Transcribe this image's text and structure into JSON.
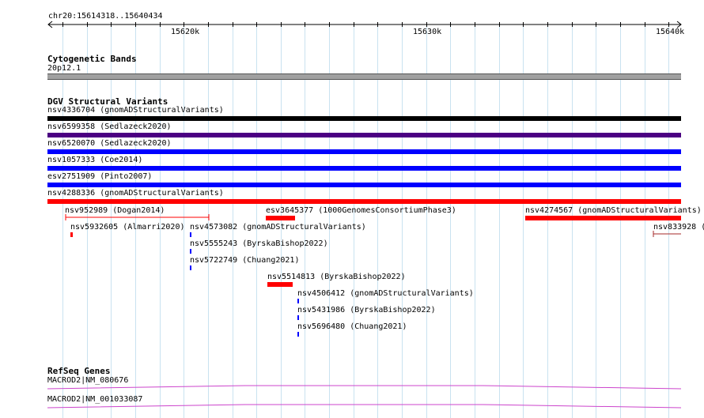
{
  "ruler": {
    "location": "chr20:15614318..15640434",
    "ticks": [
      "15620k",
      "15630k",
      "15640k"
    ]
  },
  "tracks": {
    "cytoband": {
      "title": "Cytogenetic Bands",
      "band_label": "20p12.1",
      "band_color": "#a0a0a0"
    },
    "dgv": {
      "title": "DGV Structural Variants",
      "colors": {
        "loss": "#ff0000",
        "gain": "#0000ff",
        "complex": "#000000",
        "inversion": "#4b0082",
        "brown": "#a52a2a"
      },
      "features": [
        {
          "label": "nsv4336704 (gnomADStructuralVariants)",
          "color": "#000000"
        },
        {
          "label": "nsv6599358 (Sedlazeck2020)",
          "color": "#4b0082"
        },
        {
          "label": "nsv6520070 (Sedlazeck2020)",
          "color": "#0000ff"
        },
        {
          "label": "nsv1057333 (Coe2014)",
          "color": "#0000ff"
        },
        {
          "label": "esv2751909 (Pinto2007)",
          "color": "#0000ff"
        },
        {
          "label": "nsv4288336 (gnomADStructuralVariants)",
          "color": "#ff0000"
        },
        {
          "label": "nsv952989 (Dogan2014)",
          "color": "#ff0000"
        },
        {
          "label": "esv3645377 (1000GenomesConsortiumPhase3)",
          "color": "#ff0000"
        },
        {
          "label": "nsv4274567 (gnomADStructuralVariants)",
          "color": "#ff0000"
        },
        {
          "label": "nsv5932605 (Almarri2020)",
          "color": "#ff0000"
        },
        {
          "label": "nsv4573082 (gnomADStructuralVariants)",
          "color": "#0000ff"
        },
        {
          "label": "nsv833928 (",
          "color": "#a52a2a"
        },
        {
          "label": "nsv5555243 (ByrskaBishop2022)",
          "color": "#0000ff"
        },
        {
          "label": "nsv5722749 (Chuang2021)",
          "color": "#0000ff"
        },
        {
          "label": "nsv5514813 (ByrskaBishop2022)",
          "color": "#ff0000"
        },
        {
          "label": "nsv4506412 (gnomADStructuralVariants)",
          "color": "#0000ff"
        },
        {
          "label": "nsv5431986 (ByrskaBishop2022)",
          "color": "#0000ff"
        },
        {
          "label": "nsv5696480 (Chuang2021)",
          "color": "#0000ff"
        }
      ]
    },
    "refseq": {
      "title": "RefSeq Genes",
      "color": "#cc44cc",
      "transcripts": [
        "MACROD2|NM_080676",
        "MACROD2|NM_001033087"
      ]
    }
  }
}
